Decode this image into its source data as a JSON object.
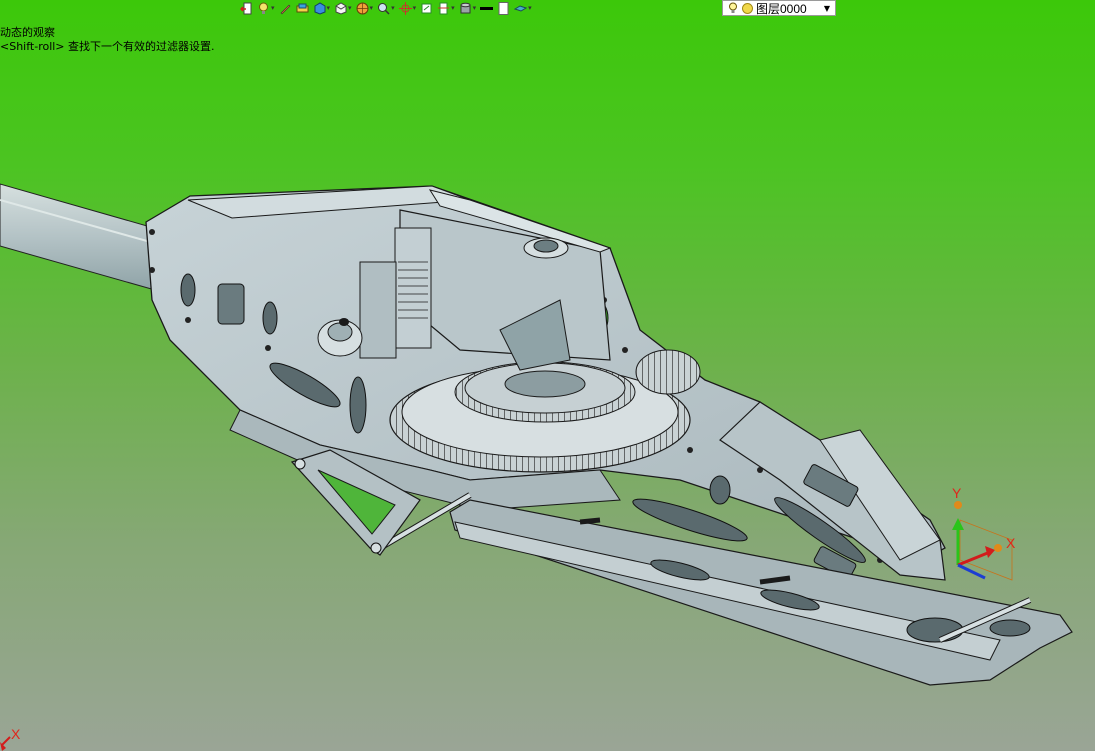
{
  "toolbar": {
    "icons": [
      "exit-sketch-icon",
      "bulb-icon",
      "pen-icon",
      "measure-icon",
      "box-icon",
      "cube-view-icon",
      "render-mode-icon",
      "zoom-icon",
      "crosshair-icon",
      "section-icon",
      "clip-icon",
      "cylinder-icon",
      "line-weight-icon",
      "page-icon",
      "plane-icon"
    ],
    "layer": {
      "name": "图层0000"
    }
  },
  "status": {
    "line1": "动态的观察",
    "line2": "<Shift-roll> 查找下一个有效的过滤器设置."
  },
  "triad": {
    "x_label": "X",
    "y_label": "Y"
  },
  "corner_axis": {
    "x_label": "X"
  },
  "colors": {
    "background_top": "#3cc80a",
    "background_bottom": "#9aa596",
    "model_face": "#b7c4c9",
    "model_edge": "#1a1a1a"
  }
}
